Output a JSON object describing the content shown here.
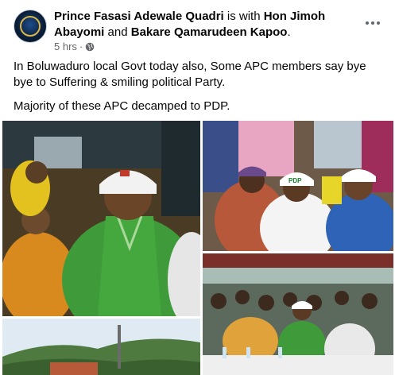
{
  "post": {
    "author": "Prince Fasasi Adewale Quadri",
    "with_text": " is with ",
    "tagged_1": "Hon Jimoh Abayomi",
    "and_text": " and ",
    "tagged_2": "Bakare Qamarudeen Kapoo",
    "end_text": ".",
    "timestamp": "5 hrs",
    "separator": "·",
    "privacy_icon": "globe-icon",
    "paragraph_1": "In Boluwaduro local Govt today also, Some APC members say bye bye to Suffering & smiling political Party.",
    "paragraph_2": "Majority of these APC decamped to PDP."
  },
  "photos": {
    "p2_cap_logo": "PDP"
  },
  "colors": {
    "text_primary": "#050505",
    "text_secondary": "#65676b",
    "icon_gray": "#606770"
  }
}
